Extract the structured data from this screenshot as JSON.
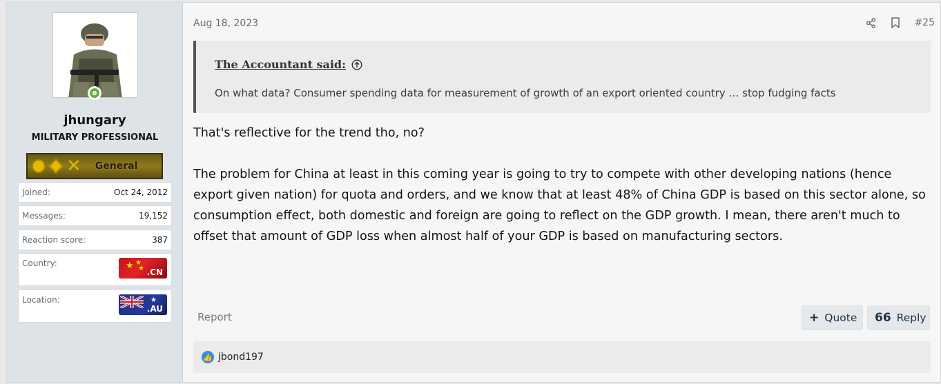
{
  "post": {
    "date": "Aug 18, 2023",
    "post_number": "#25",
    "icons": {
      "share": "share-icon",
      "bookmark": "bookmark-icon"
    }
  },
  "user": {
    "name": "jhungary",
    "title": "MILITARY PROFESSIONAL",
    "rank": "General",
    "online": true,
    "stats": [
      {
        "label": "Joined:",
        "value": "Oct 24, 2012"
      },
      {
        "label": "Messages:",
        "value": "19,152"
      },
      {
        "label": "Reaction score:",
        "value": "387"
      }
    ],
    "country": {
      "label": "Country:",
      "flag_text": ".CN"
    },
    "location": {
      "label": "Location:",
      "flag_text": ".AU"
    }
  },
  "quote": {
    "author": "The Accountant said:",
    "text": "On what data? Consumer spending data for measurement of growth of an export oriented country … stop fudging facts"
  },
  "body": {
    "para1": "That's reflective for the trend tho, no?",
    "para2": "The problem for China at least in this coming year is going to try to compete with other developing nations (hence export given nation) for quota and orders, and we know that at least 48% of China GDP is based on this sector alone, so consumption effect, both domestic and foreign are going to reflect on the GDP growth. I mean, there aren't much to offset that amount of GDP loss when almost half of your GDP is based on manufacturing sectors."
  },
  "actions": {
    "report": "Report",
    "quote": "Quote",
    "reply": "Reply"
  },
  "reactions": {
    "users": "jbond197"
  },
  "colors": {
    "accent_text": "#223345",
    "user_col_bg": "#dde3e7",
    "online": "#63b141",
    "like": "#2f8fe4"
  }
}
